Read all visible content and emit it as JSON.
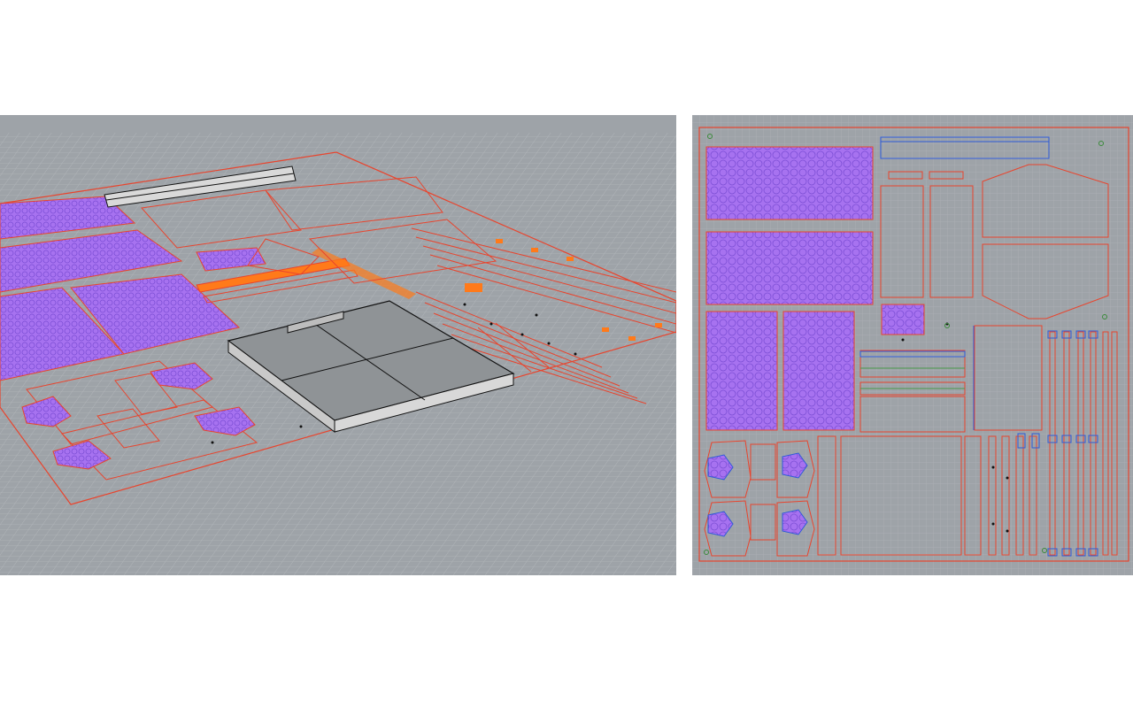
{
  "app": {
    "viewports": [
      {
        "id": "perspective",
        "label": ""
      },
      {
        "id": "top",
        "label": ""
      }
    ]
  },
  "colors": {
    "page_background": "#ffffff",
    "viewport_background": "#9ea3a8",
    "grid_minor": "#aeb2b6",
    "grid_major": "#8c9094",
    "cut_line": "#e8452e",
    "hatch_pattern": "#9b5cf6",
    "engrave_line": "#2f5bd8",
    "highlight_fill": "#ff7a1a",
    "solid_box_face": "#8f9396",
    "solid_box_edge": "#1a1a1a",
    "point_marker": "#1a1a1a"
  },
  "icons": [
    "grid-plane",
    "cut-outline",
    "hatched-panel",
    "box-solid",
    "point-marker"
  ]
}
